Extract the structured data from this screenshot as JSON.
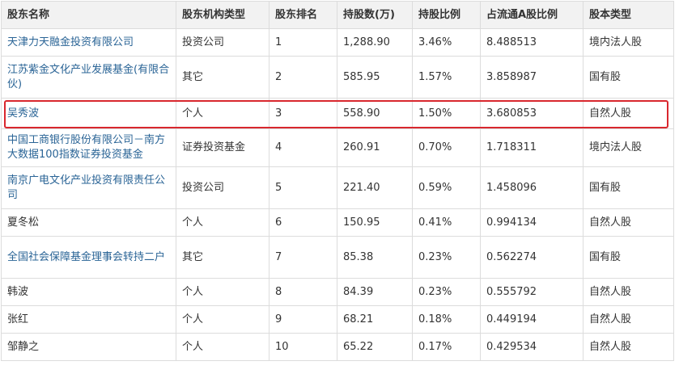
{
  "table": {
    "headers": [
      "股东名称",
      "股东机构类型",
      "股东排名",
      "持股数(万)",
      "持股比例",
      "占流通A股比例",
      "股本类型"
    ],
    "rows": [
      {
        "name": "天津力天融金投资有限公司",
        "org_type": "投资公司",
        "rank": "1",
        "shares": "1,288.90",
        "ratio": "3.46%",
        "float_ratio": "8.488513",
        "share_type": "境内法人股"
      },
      {
        "name": "江苏紫金文化产业发展基金(有限合伙)",
        "org_type": "其它",
        "rank": "2",
        "shares": "585.95",
        "ratio": "1.57%",
        "float_ratio": "3.858987",
        "share_type": "国有股"
      },
      {
        "name": "吴秀波",
        "org_type": "个人",
        "rank": "3",
        "shares": "558.90",
        "ratio": "1.50%",
        "float_ratio": "3.680853",
        "share_type": "自然人股"
      },
      {
        "name": "中国工商银行股份有限公司－南方大数据100指数证券投资基金",
        "org_type": "证券投资基金",
        "rank": "4",
        "shares": "260.91",
        "ratio": "0.70%",
        "float_ratio": "1.718311",
        "share_type": "境内法人股"
      },
      {
        "name": "南京广电文化产业投资有限责任公司",
        "org_type": "投资公司",
        "rank": "5",
        "shares": "221.40",
        "ratio": "0.59%",
        "float_ratio": "1.458096",
        "share_type": "国有股"
      },
      {
        "name": "夏冬松",
        "org_type": "个人",
        "rank": "6",
        "shares": "150.95",
        "ratio": "0.41%",
        "float_ratio": "0.994134",
        "share_type": "自然人股"
      },
      {
        "name": "全国社会保障基金理事会转持二户",
        "org_type": "其它",
        "rank": "7",
        "shares": "85.38",
        "ratio": "0.23%",
        "float_ratio": "0.562274",
        "share_type": "国有股"
      },
      {
        "name": "韩波",
        "org_type": "个人",
        "rank": "8",
        "shares": "84.39",
        "ratio": "0.23%",
        "float_ratio": "0.555792",
        "share_type": "自然人股"
      },
      {
        "name": "张红",
        "org_type": "个人",
        "rank": "9",
        "shares": "68.21",
        "ratio": "0.18%",
        "float_ratio": "0.449194",
        "share_type": "自然人股"
      },
      {
        "name": "邹静之",
        "org_type": "个人",
        "rank": "10",
        "shares": "65.22",
        "ratio": "0.17%",
        "float_ratio": "0.429534",
        "share_type": "自然人股"
      }
    ]
  },
  "highlight": {
    "row": 3,
    "color": "#d9272e"
  },
  "colors": {
    "link": "#2a6496",
    "header_bg": "#f2f2f2",
    "border": "#dcdcdc"
  }
}
